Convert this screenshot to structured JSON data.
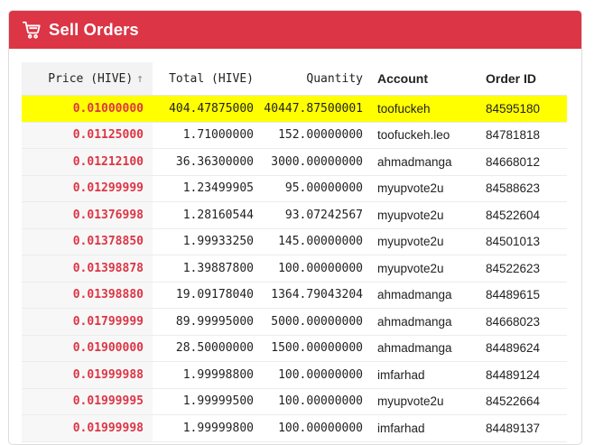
{
  "header": {
    "title": "Sell Orders"
  },
  "columns": {
    "price": "Price (HIVE)",
    "total": "Total (HIVE)",
    "quantity": "Quantity",
    "account": "Account",
    "order_id": "Order ID",
    "sort_glyph": "↑"
  },
  "rows": [
    {
      "price": "0.01000000",
      "total": "404.47875000",
      "quantity": "40447.87500001",
      "account": "toofuckeh",
      "order_id": "84595180"
    },
    {
      "price": "0.01125000",
      "total": "1.71000000",
      "quantity": "152.00000000",
      "account": "toofuckeh.leo",
      "order_id": "84781818"
    },
    {
      "price": "0.01212100",
      "total": "36.36300000",
      "quantity": "3000.00000000",
      "account": "ahmadmanga",
      "order_id": "84668012"
    },
    {
      "price": "0.01299999",
      "total": "1.23499905",
      "quantity": "95.00000000",
      "account": "myupvote2u",
      "order_id": "84588623"
    },
    {
      "price": "0.01376998",
      "total": "1.28160544",
      "quantity": "93.07242567",
      "account": "myupvote2u",
      "order_id": "84522604"
    },
    {
      "price": "0.01378850",
      "total": "1.99933250",
      "quantity": "145.00000000",
      "account": "myupvote2u",
      "order_id": "84501013"
    },
    {
      "price": "0.01398878",
      "total": "1.39887800",
      "quantity": "100.00000000",
      "account": "myupvote2u",
      "order_id": "84522623"
    },
    {
      "price": "0.01398880",
      "total": "19.09178040",
      "quantity": "1364.79043204",
      "account": "ahmadmanga",
      "order_id": "84489615"
    },
    {
      "price": "0.01799999",
      "total": "89.99995000",
      "quantity": "5000.00000000",
      "account": "ahmadmanga",
      "order_id": "84668023"
    },
    {
      "price": "0.01900000",
      "total": "28.50000000",
      "quantity": "1500.00000000",
      "account": "ahmadmanga",
      "order_id": "84489624"
    },
    {
      "price": "0.01999988",
      "total": "1.99998800",
      "quantity": "100.00000000",
      "account": "imfarhad",
      "order_id": "84489124"
    },
    {
      "price": "0.01999995",
      "total": "1.99999500",
      "quantity": "100.00000000",
      "account": "myupvote2u",
      "order_id": "84522664"
    },
    {
      "price": "0.01999998",
      "total": "1.99999800",
      "quantity": "100.00000000",
      "account": "imfarhad",
      "order_id": "84489137"
    }
  ],
  "colors": {
    "header_bg": "#dc3545",
    "price_text": "#dc3545",
    "highlight": "#ffff00"
  }
}
